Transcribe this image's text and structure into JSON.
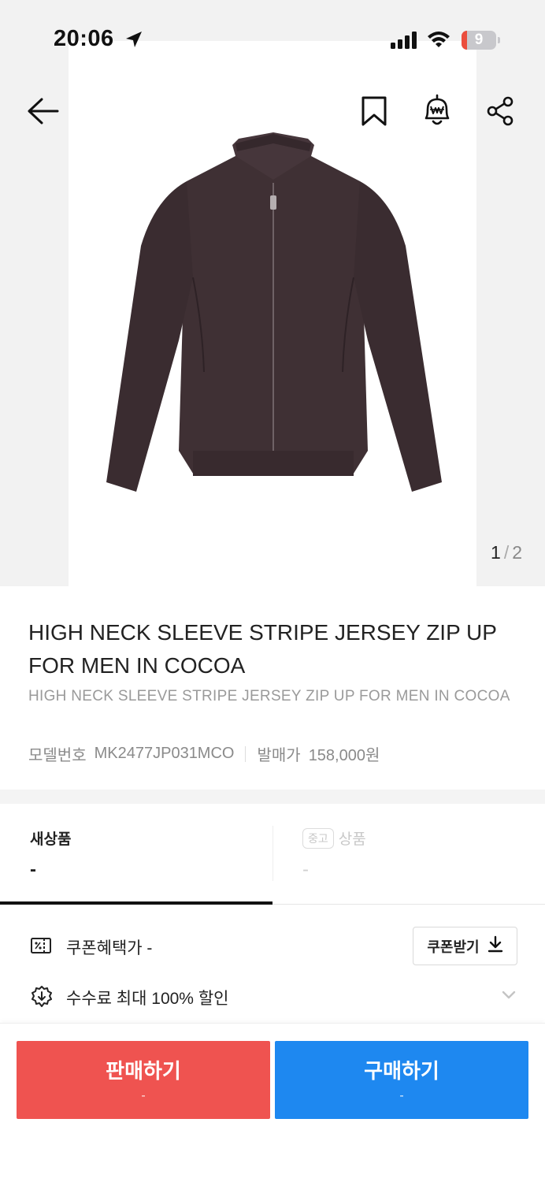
{
  "status_bar": {
    "time": "20:06",
    "battery": "9"
  },
  "gallery": {
    "current": "1",
    "separator": "/",
    "total": "2"
  },
  "product": {
    "title": "HIGH NECK SLEEVE STRIPE JERSEY ZIP UP FOR MEN IN COCOA",
    "subtitle": "HIGH NECK SLEEVE STRIPE JERSEY ZIP UP FOR MEN IN COCOA",
    "model_label": "모델번호",
    "model_value": "MK2477JP031MCO",
    "release_label": "발매가",
    "release_value": "158,000원"
  },
  "tabs": {
    "new": {
      "label": "새상품",
      "price": "-"
    },
    "used": {
      "badge": "중고",
      "label": "상품",
      "price": "-"
    }
  },
  "coupon": {
    "label": "쿠폰혜택가 -",
    "button": "쿠폰받기"
  },
  "fee": {
    "label": "수수료 최대 100% 할인"
  },
  "actions": {
    "sell": {
      "label": "판매하기",
      "sub": "-"
    },
    "buy": {
      "label": "구매하기",
      "sub": "-"
    }
  },
  "colors": {
    "sell": "#ef5350",
    "buy": "#1e88f0",
    "battery_low": "#eb4d3d"
  },
  "icons": [
    "location-arrow-icon",
    "signal-icon",
    "wifi-icon",
    "battery-icon",
    "back-arrow-icon",
    "bookmark-icon",
    "price-alert-bell-icon",
    "share-icon",
    "coupon-icon",
    "download-icon",
    "fee-discount-icon",
    "chevron-down-icon"
  ]
}
